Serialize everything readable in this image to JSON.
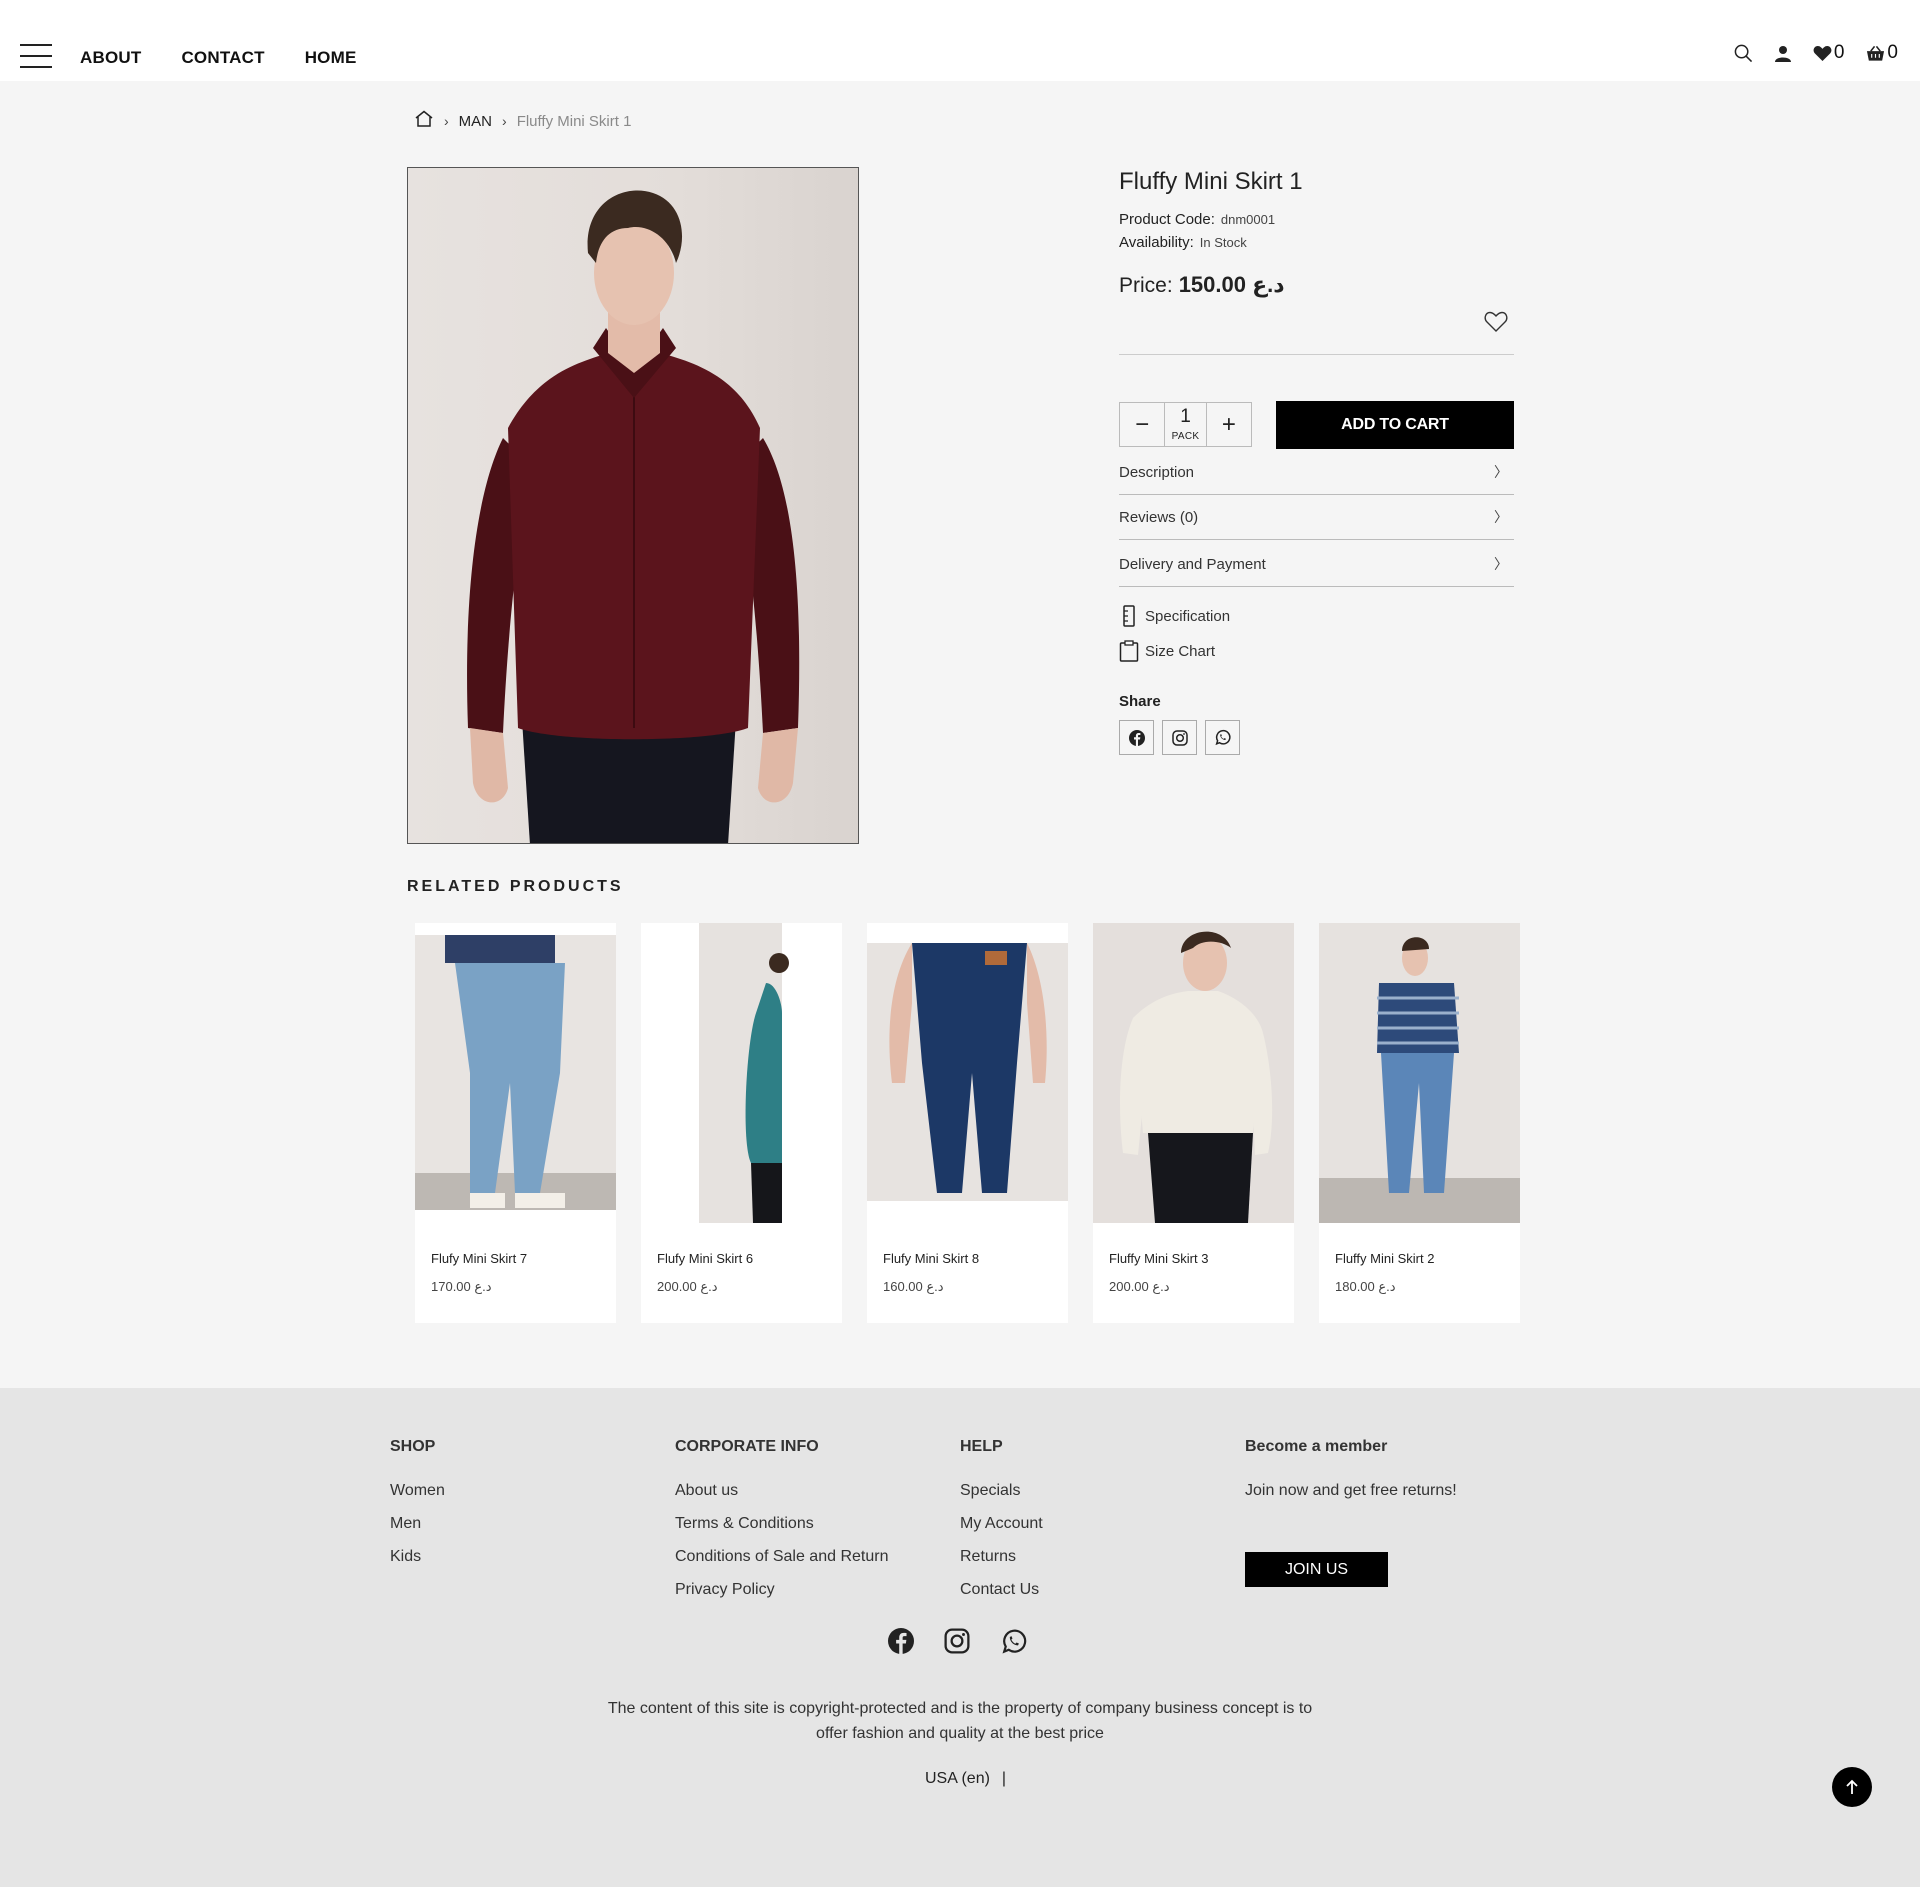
{
  "header": {
    "nav": [
      "ABOUT",
      "CONTACT",
      "HOME"
    ],
    "wishlist_count": "0",
    "cart_count": "0"
  },
  "breadcrumb": {
    "category": "MAN",
    "current": "Fluffy Mini Skirt 1"
  },
  "product": {
    "title": "Fluffy Mini Skirt 1",
    "code_label": "Product Code:",
    "code": "dnm0001",
    "availability_label": "Availability:",
    "availability": "In Stock",
    "price_label": "Price:",
    "price": "150.00 د.ع",
    "quantity": "1",
    "unit": "PACK",
    "add_to_cart": "ADD TO CART",
    "accordions": [
      "Description",
      "Reviews (0)",
      "Delivery and Payment"
    ],
    "specification": "Specification",
    "size_chart": "Size Chart",
    "share_label": "Share"
  },
  "related": {
    "title": "RELATED PRODUCTS",
    "items": [
      {
        "name": "Flufy Mini Skirt 7",
        "price": "170.00 د.ع"
      },
      {
        "name": "Flufy Mini Skirt 6",
        "price": "200.00 د.ع"
      },
      {
        "name": "Flufy Mini Skirt 8",
        "price": "160.00 د.ع"
      },
      {
        "name": "Fluffy Mini Skirt 3",
        "price": "200.00 د.ع"
      },
      {
        "name": "Fluffy Mini Skirt 2",
        "price": "180.00 د.ع"
      }
    ]
  },
  "footer": {
    "shop": {
      "title": "SHOP",
      "links": [
        "Women",
        "Men",
        "Kids"
      ]
    },
    "corporate": {
      "title": "CORPORATE INFO",
      "links": [
        "About us",
        "Terms & Conditions",
        "Conditions of Sale and Return",
        "Privacy Policy"
      ]
    },
    "help": {
      "title": "HELP",
      "links": [
        "Specials",
        "My Account",
        "Returns",
        "Contact Us"
      ]
    },
    "member": {
      "title": "Become a member",
      "text": "Join now and get free returns!",
      "button": "JOIN US"
    },
    "copyright": "The content of this site is copyright-protected and is the property of company business concept is to offer fashion and quality at the best price",
    "locale": "USA (en)",
    "locale_sep": "|"
  },
  "colors": {
    "accent": "#000000",
    "page_bg": "#f5f5f5",
    "footer_bg": "#e5e5e5"
  }
}
